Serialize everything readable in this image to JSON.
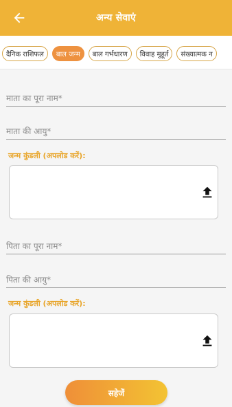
{
  "header": {
    "title": "अन्य सेवाएं",
    "back_icon": "arrow-left-icon"
  },
  "tabs": [
    {
      "label": "दैनिक राशिफल",
      "active": false
    },
    {
      "label": "बाल जन्म",
      "active": true
    },
    {
      "label": "बाल गर्भधारण",
      "active": false
    },
    {
      "label": "विवाह मुहूर्त",
      "active": false
    },
    {
      "label": "संख्यात्मक न",
      "active": false
    }
  ],
  "form": {
    "mother_name_placeholder": "माता का पूरा नाम*",
    "mother_age_placeholder": "माता की आयु*",
    "mother_kundli_label": "जन्म कुंडली (अपलोड करें):",
    "father_name_placeholder": "पिता का पूरा नाम*",
    "father_age_placeholder": "पिता की आयु*",
    "father_kundli_label": "जन्म कुंडली (अपलोड करें):",
    "upload_icon": "upload-icon"
  },
  "save_label": "सहेजें",
  "colors": {
    "header": "#efb337",
    "accent": "#ee9240",
    "label": "#e8a52a"
  }
}
